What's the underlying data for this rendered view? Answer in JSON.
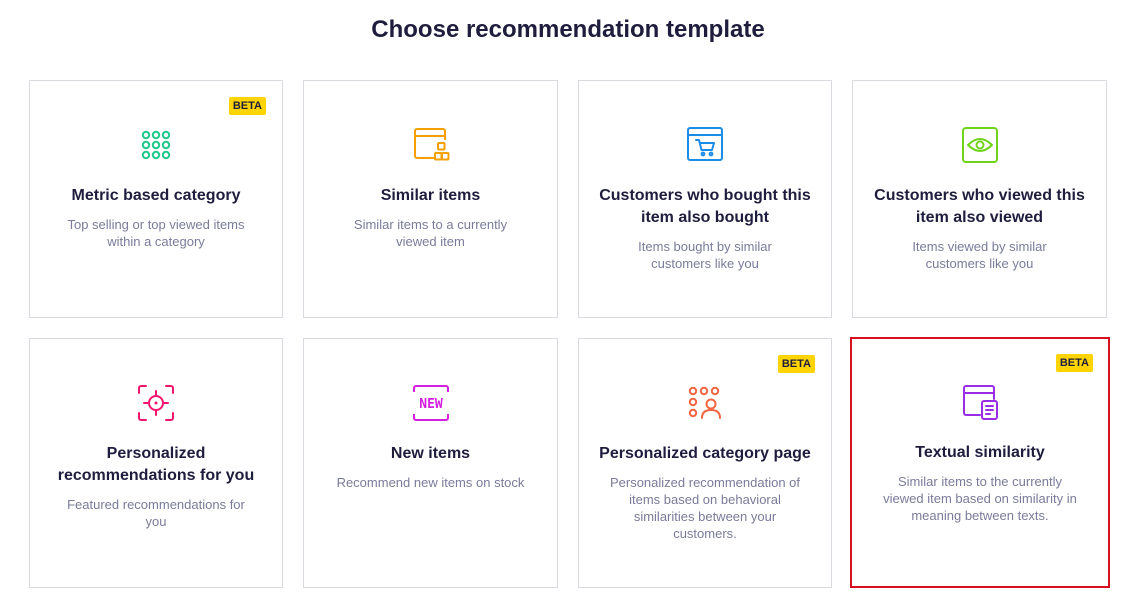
{
  "page": {
    "title": "Choose recommendation template"
  },
  "cards": [
    {
      "title": "Metric based category",
      "description": "Top selling or top viewed items within a category",
      "badge": "BETA",
      "icon": "metric-grid-icon",
      "color": "#1fc98a"
    },
    {
      "title": "Similar items",
      "description": "Similar items to a currently viewed item",
      "icon": "similar-items-icon",
      "color": "#f5a000"
    },
    {
      "title": "Customers who bought this item also bought",
      "description": "Items bought by similar customers like you",
      "icon": "shopping-cart-icon",
      "color": "#1a8de9"
    },
    {
      "title": "Customers who viewed this item also viewed",
      "description": "Items viewed by similar customers like you",
      "icon": "eye-icon",
      "color": "#6ed31a"
    },
    {
      "title": "Personalized recommendations for you",
      "description": "Featured recommendations for you",
      "icon": "target-icon",
      "color": "#f0156e"
    },
    {
      "title": "New items",
      "description": "Recommend new items on stock",
      "icon": "new-badge-icon",
      "icon_text": "NEW",
      "color": "#d41ee0"
    },
    {
      "title": "Personalized category page",
      "description": "Personalized recommendation of items based on behavioral similarities between your customers.",
      "badge": "BETA",
      "icon": "user-grid-icon",
      "color": "#f26542"
    },
    {
      "title": "Textual similarity",
      "description": "Similar items to the currently viewed item based on similarity in meaning between texts.",
      "badge": "BETA",
      "icon": "text-document-icon",
      "color": "#9a2de6",
      "selected": true
    }
  ],
  "colors": {
    "title": "#1f1d3d",
    "description": "#7a7b9a",
    "border": "#d9d9e0",
    "selected_border": "#d80f1e",
    "badge": "#ffd400"
  }
}
